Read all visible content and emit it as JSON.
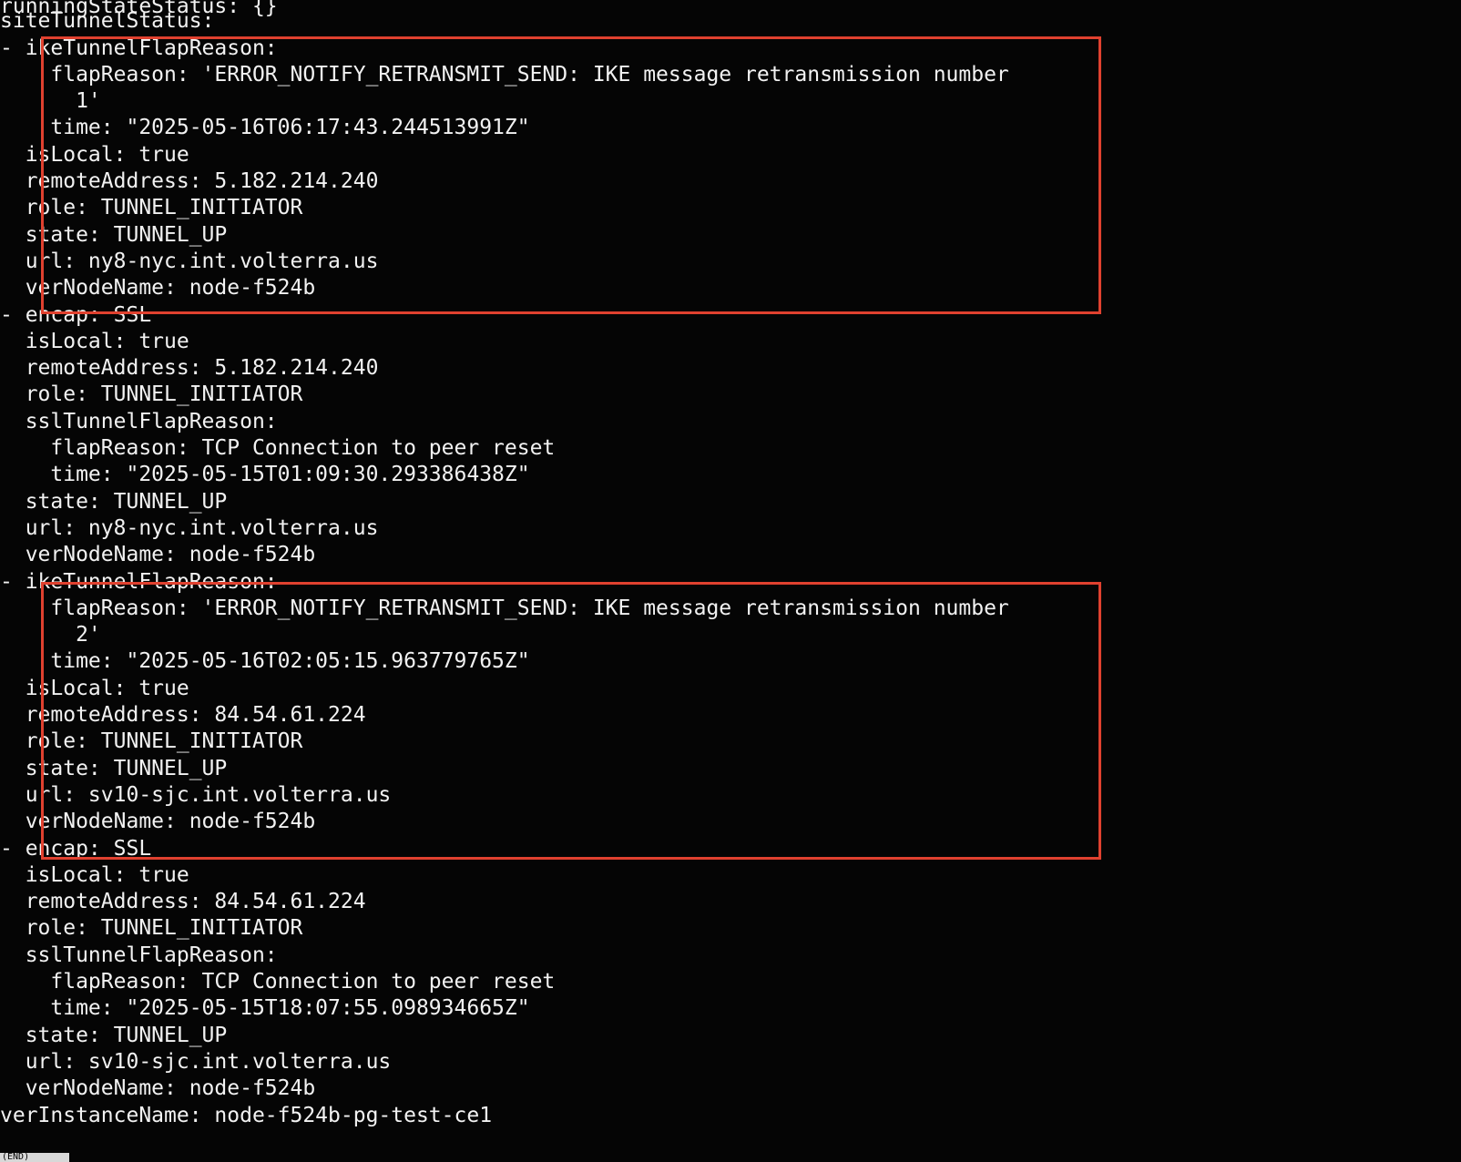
{
  "terminal": {
    "lines": [
      "runningStateStatus: {}",
      "siteTunnelStatus:",
      "- ikeTunnelFlapReason:",
      "    flapReason: 'ERROR_NOTIFY_RETRANSMIT_SEND: IKE message retransmission number",
      "      1'",
      "    time: \"2025-05-16T06:17:43.244513991Z\"",
      "  isLocal: true",
      "  remoteAddress: 5.182.214.240",
      "  role: TUNNEL_INITIATOR",
      "  state: TUNNEL_UP",
      "  url: ny8-nyc.int.volterra.us",
      "  verNodeName: node-f524b",
      "- encap: SSL",
      "  isLocal: true",
      "  remoteAddress: 5.182.214.240",
      "  role: TUNNEL_INITIATOR",
      "  sslTunnelFlapReason:",
      "    flapReason: TCP Connection to peer reset",
      "    time: \"2025-05-15T01:09:30.293386438Z\"",
      "  state: TUNNEL_UP",
      "  url: ny8-nyc.int.volterra.us",
      "  verNodeName: node-f524b",
      "- ikeTunnelFlapReason:",
      "    flapReason: 'ERROR_NOTIFY_RETRANSMIT_SEND: IKE message retransmission number",
      "      2'",
      "    time: \"2025-05-16T02:05:15.963779765Z\"",
      "  isLocal: true",
      "  remoteAddress: 84.54.61.224",
      "  role: TUNNEL_INITIATOR",
      "  state: TUNNEL_UP",
      "  url: sv10-sjc.int.volterra.us",
      "  verNodeName: node-f524b",
      "- encap: SSL",
      "  isLocal: true",
      "  remoteAddress: 84.54.61.224",
      "  role: TUNNEL_INITIATOR",
      "  sslTunnelFlapReason:",
      "    flapReason: TCP Connection to peer reset",
      "    time: \"2025-05-15T18:07:55.098934665Z\"",
      "  state: TUNNEL_UP",
      "  url: sv10-sjc.int.volterra.us",
      "  verNodeName: node-f524b",
      "verInstanceName: node-f524b-pg-test-ce1"
    ],
    "prompt_fragment": "(END)"
  },
  "colors": {
    "background": "#050505",
    "text": "#f2f2f2",
    "highlight_border": "#e0412f"
  }
}
